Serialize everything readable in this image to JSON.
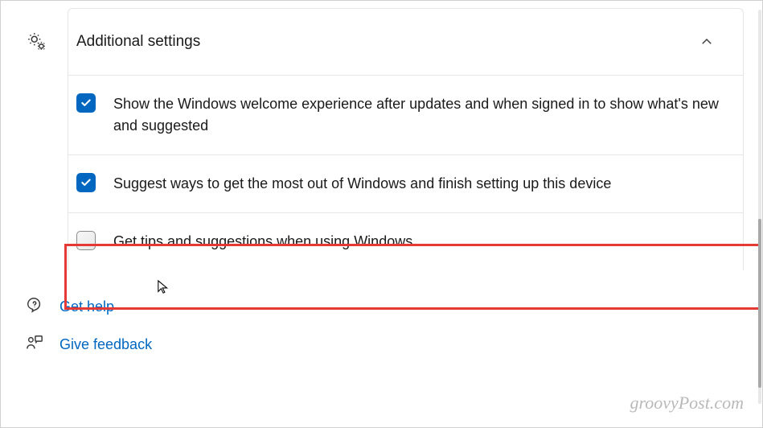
{
  "header": {
    "title": "Additional settings"
  },
  "options": [
    {
      "label": "Show the Windows welcome experience after updates and when signed in to show what's new and suggested",
      "checked": true
    },
    {
      "label": "Suggest ways to get the most out of Windows and finish setting up this device",
      "checked": true
    },
    {
      "label": "Get tips and suggestions when using Windows",
      "checked": false
    }
  ],
  "links": {
    "help": "Get help",
    "feedback": "Give feedback"
  },
  "watermark": "groovyPost.com"
}
